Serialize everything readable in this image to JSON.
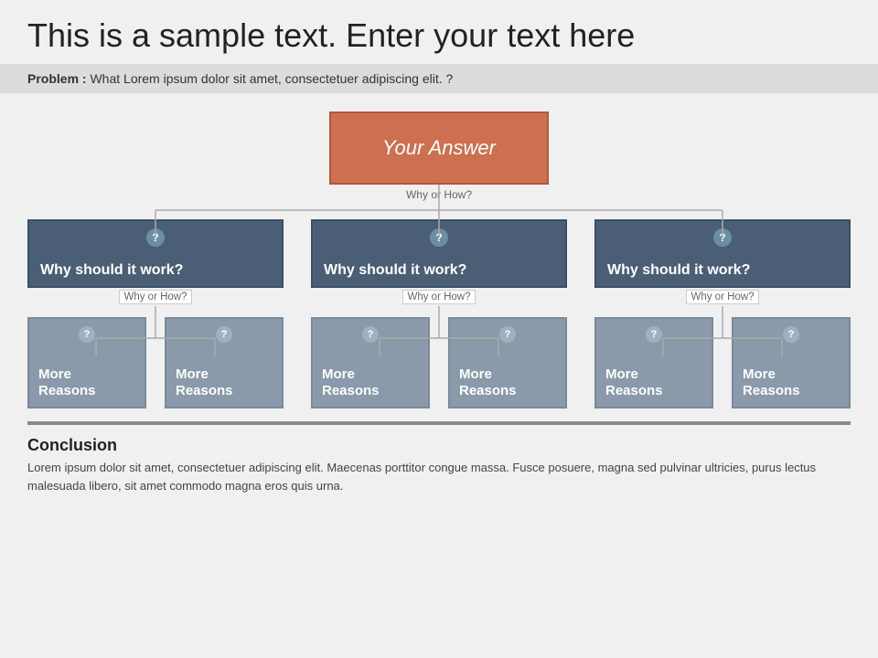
{
  "page": {
    "title": "This is a sample text. Enter your text here",
    "problem_label": "Problem :",
    "problem_text": "What Lorem ipsum dolor sit amet, consectetuer adipiscing elit. ?",
    "root_node": {
      "label": "Your Answer"
    },
    "why_root_label": "Why or How?",
    "branch_nodes": [
      {
        "label": "Why should it work?"
      },
      {
        "label": "Why should it work?"
      },
      {
        "label": "Why should it work?"
      }
    ],
    "why_branch_label": "Why or How?",
    "leaf_nodes": [
      [
        {
          "label": "More\nReasons"
        },
        {
          "label": "More\nReasons"
        }
      ],
      [
        {
          "label": "More\nReasons"
        },
        {
          "label": "More\nReasons"
        }
      ],
      [
        {
          "label": "More\nReasons"
        },
        {
          "label": "More\nReasons"
        }
      ]
    ],
    "conclusion": {
      "title": "Conclusion",
      "text": "Lorem ipsum dolor sit amet, consectetuer adipiscing elit. Maecenas porttitor congue massa. Fusce posuere, magna sed pulvinar ultricies, purus lectus malesuada libero, sit amet commodo magna eros quis urna."
    },
    "question_mark": "?",
    "colors": {
      "root_bg": "#cc7050",
      "branch_bg": "#4a5f75",
      "leaf_bg": "#8a9aaa",
      "accent": "#8a8a8a"
    }
  }
}
